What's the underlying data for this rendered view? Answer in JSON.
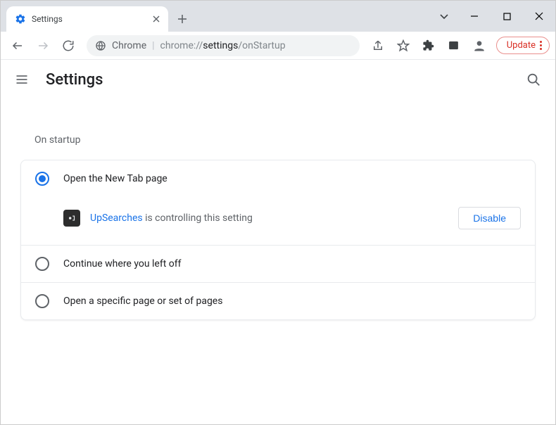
{
  "window": {
    "tab_title": "Settings"
  },
  "toolbar": {
    "chrome_label": "Chrome",
    "url_host": "chrome://",
    "url_bold": "settings",
    "url_rest": "/onStartup",
    "update_label": "Update"
  },
  "header": {
    "title": "Settings"
  },
  "startup": {
    "section_title": "On startup",
    "options": [
      {
        "label": "Open the New Tab page",
        "checked": true
      },
      {
        "label": "Continue where you left off",
        "checked": false
      },
      {
        "label": "Open a specific page or set of pages",
        "checked": false
      }
    ],
    "controlled_by": {
      "extension_name": "UpSearches",
      "suffix": " is controlling this setting",
      "disable_label": "Disable"
    }
  }
}
